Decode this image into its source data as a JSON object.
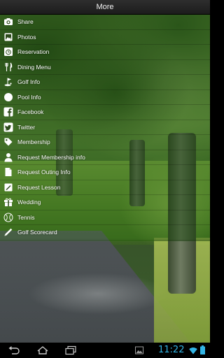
{
  "header": {
    "title": "More"
  },
  "menu": {
    "items": [
      {
        "label": "Share",
        "icon": "camera-icon"
      },
      {
        "label": "Photos",
        "icon": "photos-icon"
      },
      {
        "label": "Reservation",
        "icon": "alarm-clock-icon"
      },
      {
        "label": "Dining Menu",
        "icon": "fork-knife-icon"
      },
      {
        "label": "Golf Info",
        "icon": "golf-icon"
      },
      {
        "label": "Pool Info",
        "icon": "circle-icon"
      },
      {
        "label": "Facebook",
        "icon": "facebook-icon"
      },
      {
        "label": "Twitter",
        "icon": "twitter-icon"
      },
      {
        "label": "Membership",
        "icon": "tag-icon"
      },
      {
        "label": "Request Membership info",
        "icon": "person-icon"
      },
      {
        "label": "Request Outing Info",
        "icon": "document-icon"
      },
      {
        "label": "Request Lesson",
        "icon": "note-icon"
      },
      {
        "label": "Wedding",
        "icon": "gift-icon"
      },
      {
        "label": "Tennis",
        "icon": "tennis-ball-icon"
      },
      {
        "label": "Golf Scorecard",
        "icon": "pencil-icon"
      }
    ]
  },
  "system_bar": {
    "time": "11:22",
    "accent_color": "#33b5e5"
  }
}
